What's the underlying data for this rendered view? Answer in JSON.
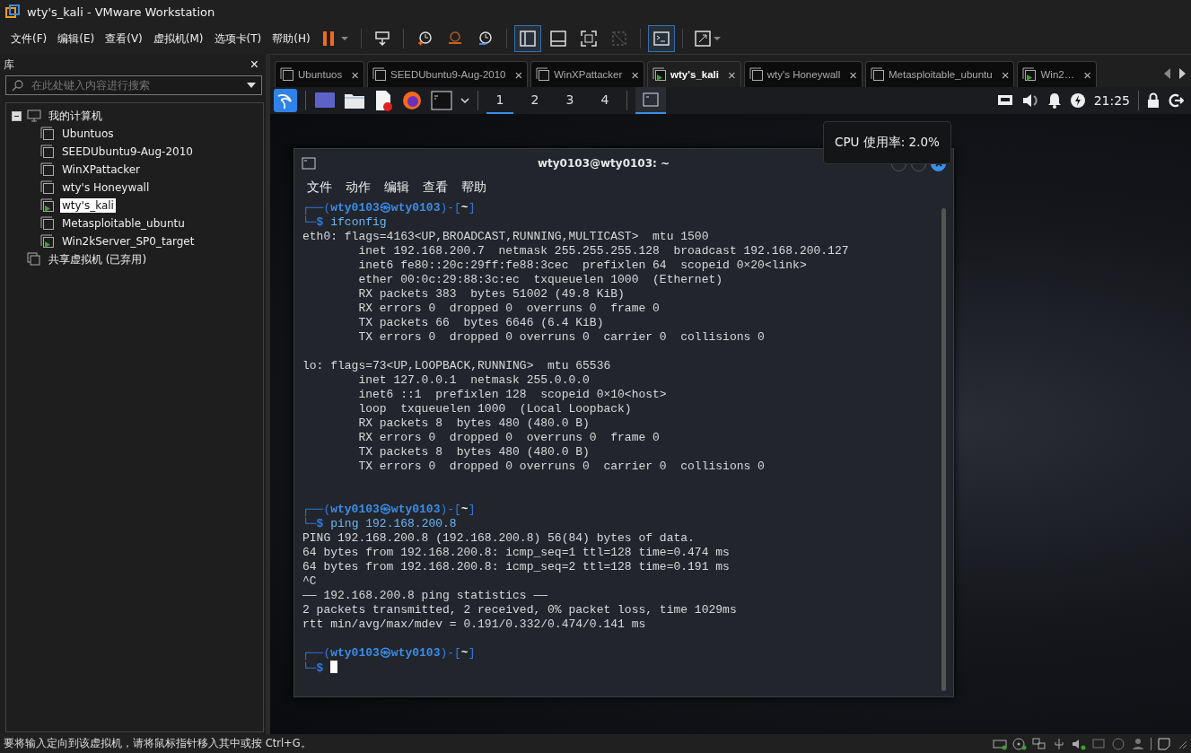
{
  "window": {
    "title": "wty's_kali - VMware Workstation"
  },
  "menu": [
    "文件(F)",
    "编辑(E)",
    "查看(V)",
    "虚拟机(M)",
    "选项卡(T)",
    "帮助(H)"
  ],
  "toolbar": [
    {
      "kind": "pause",
      "selected": false,
      "disabled": false
    },
    {
      "kind": "send-keys",
      "selected": false,
      "disabled": false
    },
    {
      "kind": "snapshot",
      "selected": false,
      "disabled": false
    },
    {
      "kind": "revert",
      "selected": false,
      "disabled": false
    },
    {
      "kind": "manager",
      "selected": false,
      "disabled": false
    },
    {
      "kind": "library",
      "selected": true,
      "disabled": false
    },
    {
      "kind": "thumbnail",
      "selected": false,
      "disabled": false
    },
    {
      "kind": "fullscreen",
      "selected": false,
      "disabled": false
    },
    {
      "kind": "unity",
      "selected": false,
      "disabled": true
    },
    {
      "kind": "console",
      "selected": true,
      "disabled": false
    },
    {
      "kind": "stretch",
      "selected": false,
      "disabled": false
    }
  ],
  "library": {
    "title": "库",
    "close": "×",
    "search": {
      "placeholder": "在此处键入内容进行搜索"
    },
    "tree": [
      {
        "label": "我的计算机",
        "expanded": true,
        "children": [
          {
            "label": "Ubuntuos",
            "running": false,
            "selected": false
          },
          {
            "label": "SEEDUbuntu9-Aug-2010",
            "running": false,
            "selected": false
          },
          {
            "label": "WinXPattacker",
            "running": false,
            "selected": false
          },
          {
            "label": "wty's Honeywall",
            "running": false,
            "selected": false
          },
          {
            "label": "wty's_kali",
            "running": true,
            "selected": true
          },
          {
            "label": "Metasploitable_ubuntu",
            "running": false,
            "selected": false
          },
          {
            "label": "Win2kServer_SP0_target",
            "running": true,
            "selected": false
          }
        ]
      },
      {
        "label": "共享虚拟机 (已弃用)",
        "expanded": false
      }
    ]
  },
  "tabs": [
    {
      "label": "Ubuntuos",
      "running": false,
      "selected": false,
      "close": "×"
    },
    {
      "label": "SEEDUbuntu9-Aug-2010",
      "running": false,
      "selected": false,
      "close": "×"
    },
    {
      "label": "WinXPattacker",
      "running": false,
      "selected": false,
      "close": "×"
    },
    {
      "label": "wty's_kali",
      "running": true,
      "selected": true,
      "close": "×"
    },
    {
      "label": "wty's Honeywall",
      "running": false,
      "selected": false,
      "close": "×"
    },
    {
      "label": "Metasploitable_ubuntu",
      "running": false,
      "selected": false,
      "close": "×"
    },
    {
      "label": "Win2…",
      "running": true,
      "selected": false,
      "close": "×"
    }
  ],
  "kali_panel": {
    "workspaces": [
      {
        "label": "1",
        "selected": true
      },
      {
        "label": "2",
        "selected": false
      },
      {
        "label": "3",
        "selected": false
      },
      {
        "label": "4",
        "selected": false
      }
    ],
    "clock": "21:25"
  },
  "tooltip": "CPU 使用率: 2.0%",
  "terminal": {
    "title": "wty0103@wty0103: ~",
    "menu": [
      "文件",
      "动作",
      "编辑",
      "查看",
      "帮助"
    ],
    "lines": [
      {
        "kind": "prompt",
        "open": "┌──(",
        "user": "wty0103㉿wty0103",
        "mid": ")-[",
        "dir": "~",
        "close": "]"
      },
      {
        "kind": "command",
        "corner": "└─",
        "sign": "$",
        "text": "ifconfig"
      },
      {
        "kind": "output",
        "text": "eth0: flags=4163<UP,BROADCAST,RUNNING,MULTICAST>  mtu 1500"
      },
      {
        "kind": "output",
        "text": "        inet 192.168.200.7  netmask 255.255.255.128  broadcast 192.168.200.127"
      },
      {
        "kind": "output",
        "text": "        inet6 fe80::20c:29ff:fe88:3cec  prefixlen 64  scopeid 0×20<link>"
      },
      {
        "kind": "output",
        "text": "        ether 00:0c:29:88:3c:ec  txqueuelen 1000  (Ethernet)"
      },
      {
        "kind": "output",
        "text": "        RX packets 383  bytes 51002 (49.8 KiB)"
      },
      {
        "kind": "output",
        "text": "        RX errors 0  dropped 0  overruns 0  frame 0"
      },
      {
        "kind": "output",
        "text": "        TX packets 66  bytes 6646 (6.4 KiB)"
      },
      {
        "kind": "output",
        "text": "        TX errors 0  dropped 0 overruns 0  carrier 0  collisions 0"
      },
      {
        "kind": "blank"
      },
      {
        "kind": "output",
        "text": "lo: flags=73<UP,LOOPBACK,RUNNING>  mtu 65536"
      },
      {
        "kind": "output",
        "text": "        inet 127.0.0.1  netmask 255.0.0.0"
      },
      {
        "kind": "output",
        "text": "        inet6 ::1  prefixlen 128  scopeid 0×10<host>"
      },
      {
        "kind": "output",
        "text": "        loop  txqueuelen 1000  (Local Loopback)"
      },
      {
        "kind": "output",
        "text": "        RX packets 8  bytes 480 (480.0 B)"
      },
      {
        "kind": "output",
        "text": "        RX errors 0  dropped 0  overruns 0  frame 0"
      },
      {
        "kind": "output",
        "text": "        TX packets 8  bytes 480 (480.0 B)"
      },
      {
        "kind": "output",
        "text": "        TX errors 0  dropped 0 overruns 0  carrier 0  collisions 0"
      },
      {
        "kind": "blank"
      },
      {
        "kind": "blank"
      },
      {
        "kind": "prompt",
        "open": "┌──(",
        "user": "wty0103㉿wty0103",
        "mid": ")-[",
        "dir": "~",
        "close": "]"
      },
      {
        "kind": "command",
        "corner": "└─",
        "sign": "$",
        "text": "ping 192.168.200.8"
      },
      {
        "kind": "output",
        "text": "PING 192.168.200.8 (192.168.200.8) 56(84) bytes of data."
      },
      {
        "kind": "output",
        "text": "64 bytes from 192.168.200.8: icmp_seq=1 ttl=128 time=0.474 ms"
      },
      {
        "kind": "output",
        "text": "64 bytes from 192.168.200.8: icmp_seq=2 ttl=128 time=0.191 ms"
      },
      {
        "kind": "output",
        "text": "^C"
      },
      {
        "kind": "output",
        "text": "—— 192.168.200.8 ping statistics ——"
      },
      {
        "kind": "output",
        "text": "2 packets transmitted, 2 received, 0% packet loss, time 1029ms"
      },
      {
        "kind": "output",
        "text": "rtt min/avg/max/mdev = 0.191/0.332/0.474/0.141 ms"
      },
      {
        "kind": "blank"
      },
      {
        "kind": "prompt",
        "open": "┌──(",
        "user": "wty0103㉿wty0103",
        "mid": ")-[",
        "dir": "~",
        "close": "]"
      },
      {
        "kind": "cursor",
        "corner": "└─",
        "sign": "$"
      }
    ]
  },
  "status_bar": {
    "message": "要将输入定向到该虚拟机，请将鼠标指针移入其中或按 Ctrl+G。"
  }
}
